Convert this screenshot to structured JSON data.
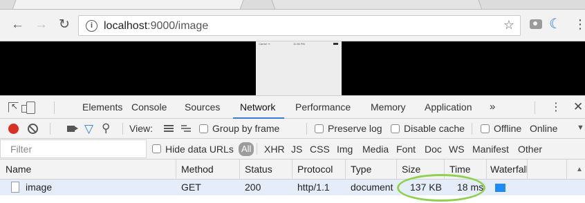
{
  "browser": {
    "url_host": "localhost",
    "url_rest": ":9000/image",
    "info_glyph": "i",
    "star_glyph": "☆",
    "menu_glyph": "⋮"
  },
  "viewport": {
    "phone_carrier": "Carrier ᯤ",
    "phone_time": "11:36 PM"
  },
  "devtools": {
    "tabs": [
      "Elements",
      "Console",
      "Sources",
      "Network",
      "Performance",
      "Memory",
      "Application"
    ],
    "active_tab": "Network",
    "more_glyph": "»",
    "kebab_glyph": "⋮",
    "close_glyph": "✕"
  },
  "toolbar": {
    "view_label": "View:",
    "group_by_frame": "Group by frame",
    "preserve_log": "Preserve log",
    "disable_cache": "Disable cache",
    "offline": "Offline",
    "throttle_value": "Online"
  },
  "filter": {
    "placeholder": "Filter",
    "hide_data_urls": "Hide data URLs",
    "types": [
      "All",
      "XHR",
      "JS",
      "CSS",
      "Img",
      "Media",
      "Font",
      "Doc",
      "WS",
      "Manifest",
      "Other"
    ]
  },
  "table": {
    "columns": [
      "Name",
      "Method",
      "Status",
      "Protocol",
      "Type",
      "Size",
      "Time",
      "Waterfall"
    ],
    "rows": [
      {
        "name": "image",
        "method": "GET",
        "status": "200",
        "protocol": "http/1.1",
        "type": "document",
        "size": "137 KB",
        "time": "18 ms"
      }
    ]
  },
  "colors": {
    "accent": "#3879d9",
    "record": "#d93025",
    "waterfall": "#1f8af0",
    "highlight": "#8fd14f"
  }
}
